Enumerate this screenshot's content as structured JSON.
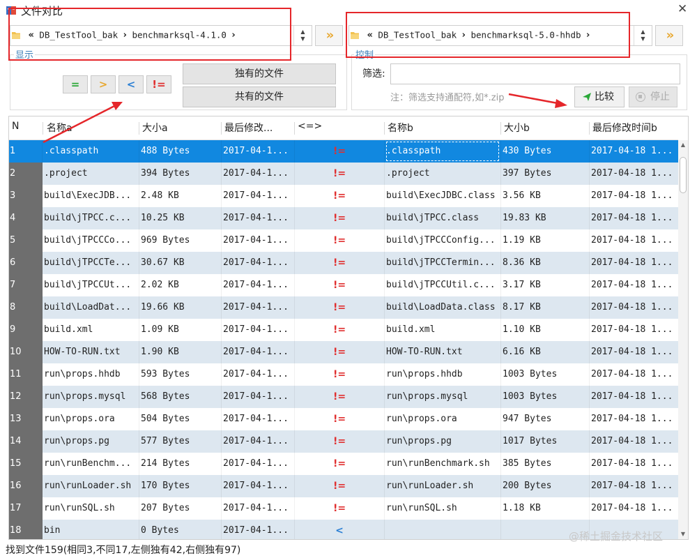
{
  "window": {
    "title": "文件对比",
    "close": "✕"
  },
  "left_path": {
    "back": "«",
    "root": "DB_TestTool_bak",
    "sep": "›",
    "folder": "benchmarksql-4.1.0",
    "more": "›"
  },
  "right_path": {
    "back": "«",
    "root": "DB_TestTool_bak",
    "sep": "›",
    "folder": "benchmarksql-5.0-hhdb",
    "more": "›"
  },
  "go_label": "»",
  "display_group": {
    "label": "显示"
  },
  "control_group": {
    "label": "控制"
  },
  "buttons": {
    "equal": "=",
    "greater": ">",
    "less": "<",
    "notequal": "!=",
    "unique_files": "独有的文件",
    "shared_files": "共有的文件",
    "compare": "比较",
    "stop": "停止"
  },
  "filter": {
    "label": "筛选:",
    "value": "",
    "hint": "注：筛选支持通配符,如*.zip"
  },
  "columns": {
    "n": "N",
    "name_a": "名称a",
    "size_a": "大小a",
    "mtime_a": "最后修改...",
    "cmp": "<=>",
    "name_b": "名称b",
    "size_b": "大小b",
    "mtime_b": "最后修改时间b"
  },
  "rows": [
    {
      "n": "1",
      "name_a": ".classpath",
      "size_a": "488 Bytes",
      "mtime_a": "2017-04-1...",
      "cmp": "!=",
      "name_b": ".classpath",
      "size_b": "430 Bytes",
      "mtime_b": "2017-04-18 1..."
    },
    {
      "n": "2",
      "name_a": ".project",
      "size_a": "394 Bytes",
      "mtime_a": "2017-04-1...",
      "cmp": "!=",
      "name_b": ".project",
      "size_b": "397 Bytes",
      "mtime_b": "2017-04-18 1..."
    },
    {
      "n": "3",
      "name_a": "build\\ExecJDB...",
      "size_a": "2.48 KB",
      "mtime_a": "2017-04-1...",
      "cmp": "!=",
      "name_b": "build\\ExecJDBC.class",
      "size_b": "3.56 KB",
      "mtime_b": "2017-04-18 1..."
    },
    {
      "n": "4",
      "name_a": "build\\jTPCC.c...",
      "size_a": "10.25 KB",
      "mtime_a": "2017-04-1...",
      "cmp": "!=",
      "name_b": "build\\jTPCC.class",
      "size_b": "19.83 KB",
      "mtime_b": "2017-04-18 1..."
    },
    {
      "n": "5",
      "name_a": "build\\jTPCCCo...",
      "size_a": "969 Bytes",
      "mtime_a": "2017-04-1...",
      "cmp": "!=",
      "name_b": "build\\jTPCCConfig...",
      "size_b": "1.19 KB",
      "mtime_b": "2017-04-18 1..."
    },
    {
      "n": "6",
      "name_a": "build\\jTPCCTe...",
      "size_a": "30.67 KB",
      "mtime_a": "2017-04-1...",
      "cmp": "!=",
      "name_b": "build\\jTPCCTermin...",
      "size_b": "8.36 KB",
      "mtime_b": "2017-04-18 1..."
    },
    {
      "n": "7",
      "name_a": "build\\jTPCCUt...",
      "size_a": "2.02 KB",
      "mtime_a": "2017-04-1...",
      "cmp": "!=",
      "name_b": "build\\jTPCCUtil.c...",
      "size_b": "3.17 KB",
      "mtime_b": "2017-04-18 1..."
    },
    {
      "n": "8",
      "name_a": "build\\LoadDat...",
      "size_a": "19.66 KB",
      "mtime_a": "2017-04-1...",
      "cmp": "!=",
      "name_b": "build\\LoadData.class",
      "size_b": "8.17 KB",
      "mtime_b": "2017-04-18 1..."
    },
    {
      "n": "9",
      "name_a": "build.xml",
      "size_a": "1.09 KB",
      "mtime_a": "2017-04-1...",
      "cmp": "!=",
      "name_b": "build.xml",
      "size_b": "1.10 KB",
      "mtime_b": "2017-04-18 1..."
    },
    {
      "n": "10",
      "name_a": "HOW-TO-RUN.txt",
      "size_a": "1.90 KB",
      "mtime_a": "2017-04-1...",
      "cmp": "!=",
      "name_b": "HOW-TO-RUN.txt",
      "size_b": "6.16 KB",
      "mtime_b": "2017-04-18 1..."
    },
    {
      "n": "11",
      "name_a": "run\\props.hhdb",
      "size_a": "593 Bytes",
      "mtime_a": "2017-04-1...",
      "cmp": "!=",
      "name_b": "run\\props.hhdb",
      "size_b": "1003 Bytes",
      "mtime_b": "2017-04-18 1..."
    },
    {
      "n": "12",
      "name_a": "run\\props.mysql",
      "size_a": "568 Bytes",
      "mtime_a": "2017-04-1...",
      "cmp": "!=",
      "name_b": "run\\props.mysql",
      "size_b": "1003 Bytes",
      "mtime_b": "2017-04-18 1..."
    },
    {
      "n": "13",
      "name_a": "run\\props.ora",
      "size_a": "504 Bytes",
      "mtime_a": "2017-04-1...",
      "cmp": "!=",
      "name_b": "run\\props.ora",
      "size_b": "947 Bytes",
      "mtime_b": "2017-04-18 1..."
    },
    {
      "n": "14",
      "name_a": "run\\props.pg",
      "size_a": "577 Bytes",
      "mtime_a": "2017-04-1...",
      "cmp": "!=",
      "name_b": "run\\props.pg",
      "size_b": "1017 Bytes",
      "mtime_b": "2017-04-18 1..."
    },
    {
      "n": "15",
      "name_a": "run\\runBenchm...",
      "size_a": "214 Bytes",
      "mtime_a": "2017-04-1...",
      "cmp": "!=",
      "name_b": "run\\runBenchmark.sh",
      "size_b": "385 Bytes",
      "mtime_b": "2017-04-18 1..."
    },
    {
      "n": "16",
      "name_a": "run\\runLoader.sh",
      "size_a": "170 Bytes",
      "mtime_a": "2017-04-1...",
      "cmp": "!=",
      "name_b": "run\\runLoader.sh",
      "size_b": "200 Bytes",
      "mtime_b": "2017-04-18 1..."
    },
    {
      "n": "17",
      "name_a": "run\\runSQL.sh",
      "size_a": "207 Bytes",
      "mtime_a": "2017-04-1...",
      "cmp": "!=",
      "name_b": "run\\runSQL.sh",
      "size_b": "1.18 KB",
      "mtime_b": "2017-04-18 1..."
    },
    {
      "n": "18",
      "name_a": "bin",
      "size_a": "0 Bytes",
      "mtime_a": "2017-04-1...",
      "cmp": "<",
      "name_b": "",
      "size_b": "",
      "mtime_b": ""
    }
  ],
  "selected_row": 0,
  "status": {
    "text": "找到文件159(相同3,不同17,左侧独有42,右侧独有97)"
  },
  "watermark": "@稀土掘金技术社区",
  "colors": {
    "selection": "#1188e0",
    "alt_row": "#dde7f0",
    "diff_mark": "#e03030",
    "less_mark": "#2a7fd4",
    "annotation": "#e5262a"
  }
}
